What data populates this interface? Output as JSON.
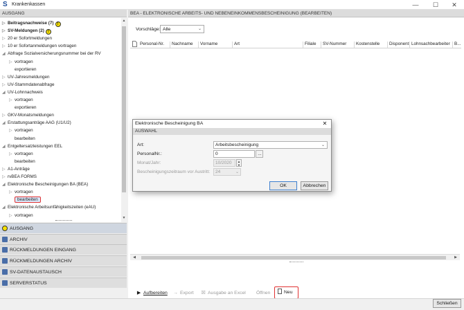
{
  "window": {
    "title": "Krankenkassen",
    "minimize": "—",
    "maximize": "☐",
    "close": "✕"
  },
  "left_panel": {
    "header": "AUSGANG",
    "tree": [
      {
        "label": "Beitragsnachweise (7)",
        "bold": true,
        "warn": true,
        "arrow": "▷",
        "indent": 0
      },
      {
        "label": "SV-Meldungen (2)",
        "bold": true,
        "warn": true,
        "arrow": "▷",
        "indent": 0
      },
      {
        "label": "20 er Sofortmeldungen",
        "arrow": "▷",
        "indent": 0
      },
      {
        "label": "10 er Sofortanmeldungen vortragen",
        "arrow": "▷",
        "indent": 0
      },
      {
        "label": "Abfrage Sozialversicherungsnummer bei der RV",
        "arrow": "◢",
        "indent": 0
      },
      {
        "label": "vortragen",
        "arrow": "▷",
        "indent": 1
      },
      {
        "label": "exportieren",
        "arrow": "",
        "indent": 1
      },
      {
        "label": "UV-Jahresmeldungen",
        "arrow": "▷",
        "indent": 0
      },
      {
        "label": "UV-Stammdatenabfrage",
        "arrow": "▷",
        "indent": 0
      },
      {
        "label": "UV-Lohnnachweis",
        "arrow": "◢",
        "indent": 0
      },
      {
        "label": "vortragen",
        "arrow": "▷",
        "indent": 1
      },
      {
        "label": "exportieren",
        "arrow": "",
        "indent": 1
      },
      {
        "label": "GKV-Monatsmeldungen",
        "arrow": "▷",
        "indent": 0
      },
      {
        "label": "Erstattungsanträge AAG (U1/U2)",
        "arrow": "◢",
        "indent": 0
      },
      {
        "label": "vortragen",
        "arrow": "▷",
        "indent": 1
      },
      {
        "label": "bearbeiten",
        "arrow": "",
        "indent": 1
      },
      {
        "label": "Entgeltersatzleistungen EEL",
        "arrow": "◢",
        "indent": 0
      },
      {
        "label": "vortragen",
        "arrow": "▷",
        "indent": 1
      },
      {
        "label": "bearbeiten",
        "arrow": "",
        "indent": 1
      },
      {
        "label": "A1-Anträge",
        "arrow": "▷",
        "indent": 0
      },
      {
        "label": "rvBEA FORMS",
        "arrow": "▷",
        "indent": 0
      },
      {
        "label": "Elektronische Bescheinigungen BA (BEA)",
        "arrow": "◢",
        "indent": 0
      },
      {
        "label": "vortragen",
        "arrow": "▷",
        "indent": 1
      },
      {
        "label": "bearbeiten",
        "arrow": "",
        "indent": 1,
        "selected": true
      },
      {
        "label": "Elektronische Arbeitsunfähigkeitszeiten (eAU)",
        "arrow": "◢",
        "indent": 0
      },
      {
        "label": "vortragen",
        "arrow": "▷",
        "indent": 1
      }
    ],
    "nav_sections": [
      {
        "label": "AUSGANG",
        "icon": "warning-icon",
        "active": true
      },
      {
        "label": "ARCHIV",
        "icon": "archive-icon"
      },
      {
        "label": "RÜCKMELDUNGEN EINGANG",
        "icon": "inbox-icon"
      },
      {
        "label": "RÜCKMELDUNGEN ARCHIV",
        "icon": "inbox-archive-icon"
      },
      {
        "label": "SV-DATENAUSTAUSCH",
        "icon": "exchange-icon"
      },
      {
        "label": "SERVERSTATUS",
        "icon": "server-status-icon"
      }
    ]
  },
  "right_panel": {
    "header": "BEA - ELEKTRONISCHE ARBEITS- UND NEBENEINKOMMENSBESCHEINIGUNG (BEARBEITEN)",
    "vorschlaege_label": "Vorschläge:",
    "vorschlaege_value": "Alle",
    "columns": [
      "Personal-Nr.",
      "Nachname",
      "Vorname",
      "Art",
      "Filiale",
      "SV-Nummer",
      "Kostenstelle",
      "Disponent",
      "Lohnsachbearbeiter",
      "B..."
    ]
  },
  "toolbar": {
    "aufbereiten": "Aufbereiten",
    "export": "Export",
    "ausgabe_excel": "Ausgabe an Excel",
    "oeffnen": "Öffnen",
    "neu": "Neu"
  },
  "status": {
    "close_button": "Schließen"
  },
  "dialog": {
    "title": "Elektronische Bescheinigung BA",
    "section": "AUSWAHL",
    "art_label": "Art:",
    "art_value": "Arbeitsbescheinigung",
    "personalnr_label": "PersonalNr.:",
    "personalnr_value": "0",
    "browse": "...",
    "monat_label": "Monat/Jahr:",
    "monat_value": "10/2020",
    "zeitraum_label": "Bescheinigungszeitraum vor Austritt:",
    "zeitraum_value": "24",
    "ok": "OK",
    "abbrechen": "Abbrechen"
  }
}
